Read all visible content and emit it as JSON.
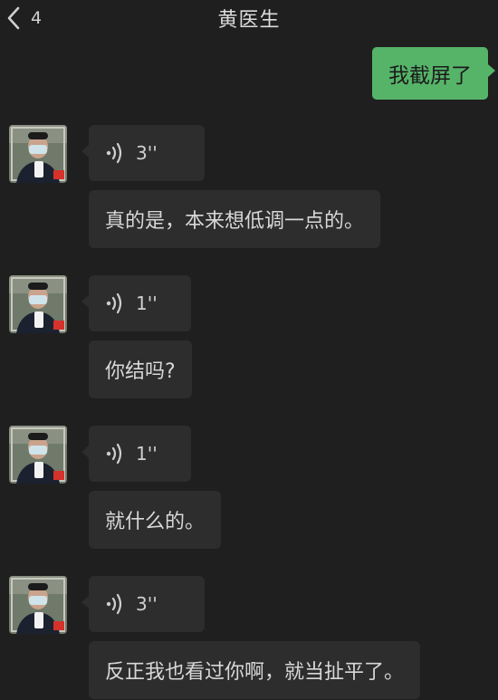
{
  "header": {
    "back_count": "4",
    "title": "黄医生"
  },
  "messages": {
    "me_text": "我截屏了",
    "groups": [
      {
        "voice_duration": "3''",
        "text": "真的是，本来想低调一点的。"
      },
      {
        "voice_duration": "1''",
        "text": "你结吗?"
      },
      {
        "voice_duration": "1''",
        "text": "就什么的。"
      },
      {
        "voice_duration": "3''",
        "text": "反正我也看过你啊，就当扯平了。"
      }
    ]
  },
  "colors": {
    "background": "#1f1f1f",
    "bubble_other": "#2d2d2d",
    "bubble_me": "#56b469"
  },
  "icons": {
    "back": "chevron-left-icon",
    "voice": "voice-wave-icon"
  }
}
